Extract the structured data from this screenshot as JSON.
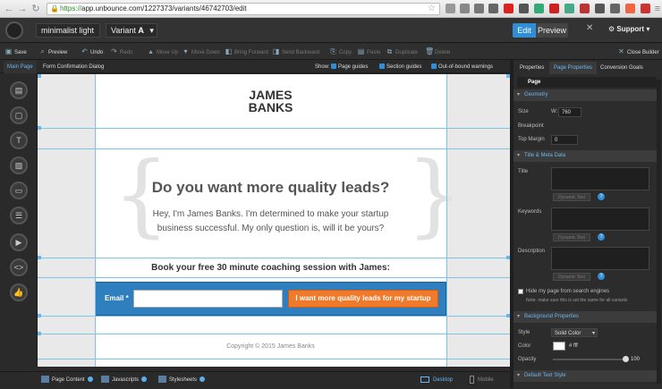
{
  "browser": {
    "url_protocol": "https://",
    "url_rest": "app.unbounce.com/1227373/variants/46742703/edit"
  },
  "header": {
    "page_name": "minimalist light",
    "variant_prefix": "Variant",
    "variant_letter": "A",
    "edit_label": "Edit",
    "preview_label": "Preview",
    "support_label": "Support"
  },
  "toolbar": {
    "save": "Save",
    "preview": "Preview",
    "undo": "Undo",
    "redo": "Redo",
    "move_up": "Move Up",
    "move_down": "Move Down",
    "bring_forward": "Bring Forward",
    "send_backward": "Send Backward",
    "copy": "Copy",
    "paste": "Paste",
    "duplicate": "Duplicate",
    "delete": "Delete",
    "close_builder": "Close Builder"
  },
  "tabs": {
    "main_page": "Main Page",
    "form_confirmation": "Form Confirmation Dialog",
    "show_label": "Show:",
    "page_guides": "Page guides",
    "section_guides": "Section guides",
    "out_of_bound": "Out-of-bound warnings"
  },
  "page": {
    "brand_line1": "JAMES",
    "brand_line2": "BANKS",
    "headline": "Do you want more quality leads?",
    "subtext": "Hey, I'm James Banks. I'm determined to make your startup business successful. My only question is, will it be yours?",
    "book_line": "Book your free 30 minute coaching session with James:",
    "email_label": "Email *",
    "cta_label": "I want more quality leads for my startup",
    "copyright": "Copyright © 2015 James Banks"
  },
  "right_panel": {
    "tab_properties": "Properties",
    "tab_page_properties": "Page Properties",
    "tab_conversion_goals": "Conversion Goals",
    "page_header": "Page",
    "geometry": "Geometry",
    "size_label": "Size",
    "size_w_label": "W:",
    "size_value": "760",
    "breakpoint_label": "Breakpoint",
    "top_margin_label": "Top Margin",
    "top_margin_value": "0",
    "title_meta": "Title & Meta Data",
    "title_label": "Title",
    "keywords_label": "Keywords",
    "description_label": "Description",
    "dynamic_text": "Dynamic Text",
    "hide_search": "Hide my page from search engines",
    "hide_note": "Note: make sure this is set the same for all variants",
    "background_props": "Background Properties",
    "style_label": "Style",
    "style_value": "Solid Color",
    "color_label": "Color",
    "color_value": "# fff",
    "opacity_label": "Opacity",
    "opacity_value": "100",
    "default_text_style": "Default Text Style"
  },
  "bottom": {
    "page_content": "Page Content",
    "javascripts": "Javascripts",
    "stylesheets": "Stylesheets",
    "desktop": "Desktop",
    "mobile": "Mobile"
  },
  "colors": {
    "accent": "#2f8ed5",
    "form_bar": "#2f7fbf",
    "cta": "#f07a2a"
  }
}
